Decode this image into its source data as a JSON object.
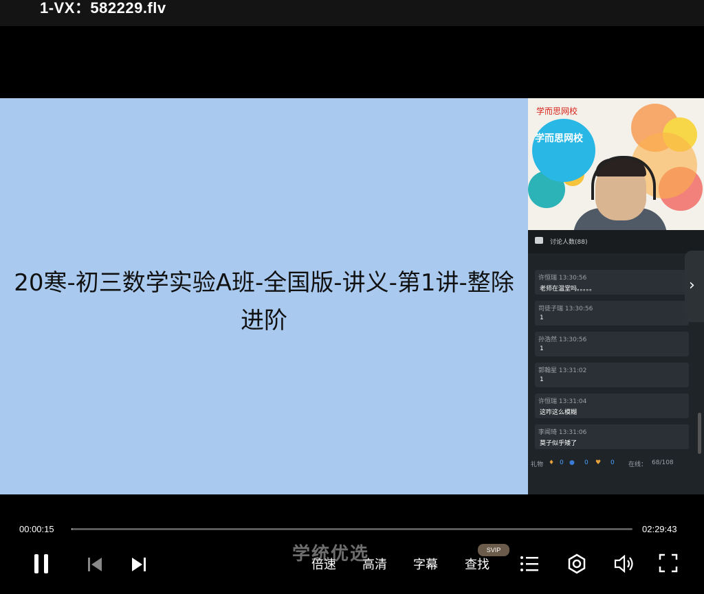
{
  "window": {
    "title": "1-VX：582229.flv"
  },
  "slide": {
    "title": "20寒-初三数学实验A班-全国版-讲义-第1讲-整除进阶"
  },
  "camera": {
    "brand_top": "学而思网校",
    "brand_mid": "学而思网校"
  },
  "chat": {
    "header": "讨论人数(88)",
    "messages": [
      {
        "name": "许恒瑞",
        "time": "13:30:56",
        "text": "老师在温堂吗。。。。。"
      },
      {
        "name": "司徒子瑞",
        "time": "13:30:56",
        "text": "1"
      },
      {
        "name": "孙浩然",
        "time": "13:30:56",
        "text": "1"
      },
      {
        "name": "郭翰星",
        "time": "13:31:02",
        "text": "1"
      },
      {
        "name": "许恒瑞",
        "time": "13:31:04",
        "text": "这咋这么模糊"
      },
      {
        "name": "李闻琦",
        "time": "13:31:06",
        "text": "莫子似乎矮了"
      }
    ],
    "footer": {
      "gift_label": "礼物",
      "gift_counts": [
        "0",
        "0",
        "0"
      ],
      "online_label": "在线：",
      "online_value": "68/108"
    }
  },
  "player": {
    "current_time": "00:00:15",
    "total_time": "02:29:43",
    "progress_fraction": 0.0017,
    "speed_label": "倍速",
    "quality_label": "高清",
    "subtitle_label": "字幕",
    "search_label": "查找",
    "svip_badge": "SVIP"
  },
  "watermark": {
    "text": "学统优选"
  },
  "icons": {
    "pause": "pause-icon",
    "prev": "previous-icon",
    "next": "next-icon",
    "playlist": "playlist-icon",
    "settings": "settings-icon",
    "volume": "volume-icon",
    "fullscreen": "fullscreen-icon",
    "expand": "chevron-right-icon"
  }
}
